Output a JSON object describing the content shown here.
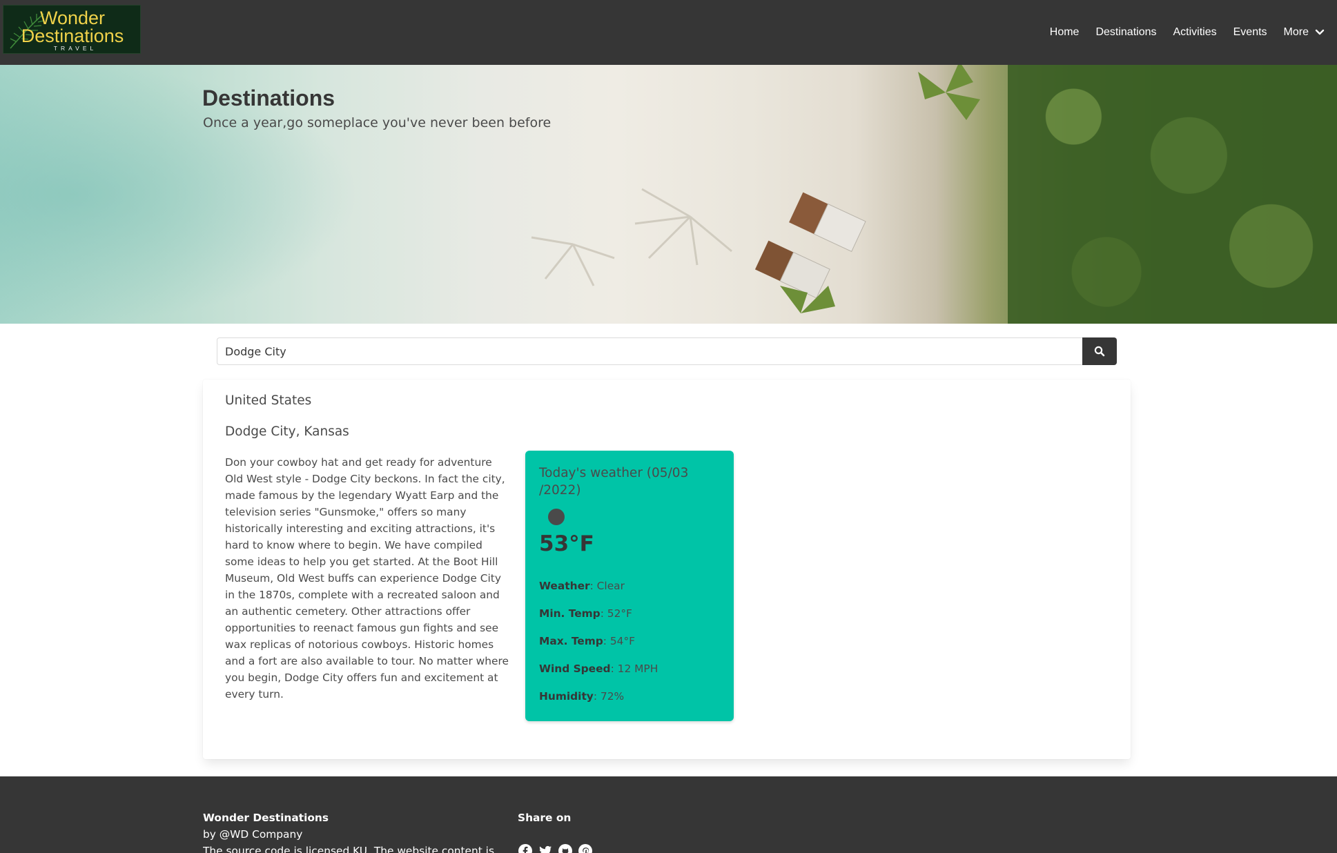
{
  "brand": {
    "logo_line1": "Wonder",
    "logo_line2": "Destinations",
    "logo_line3": "TRAVEL"
  },
  "nav": {
    "items": [
      {
        "label": "Home"
      },
      {
        "label": "Destinations"
      },
      {
        "label": "Activities"
      },
      {
        "label": "Events"
      },
      {
        "label": "More"
      }
    ]
  },
  "hero": {
    "title": "Destinations",
    "subtitle": "Once a year,go someplace you've never been before"
  },
  "search": {
    "value": "Dodge City",
    "button_icon": "search-icon"
  },
  "result": {
    "country": "United States",
    "city": "Dodge City, Kansas",
    "description": "Don your cowboy hat and get ready for adventure Old West style - Dodge City beckons. In fact the city, made famous by the legendary Wyatt Earp and the television series \"Gunsmoke,\" offers so many historically interesting and exciting attractions, it's hard to know where to begin. We have compiled some ideas to help you get started. At the Boot Hill Museum, Old West buffs can experience Dodge City in the 1870s, complete with a recreated saloon and an authentic cemetery. Other attractions offer opportunities to reenact famous gun fights and see wax replicas of notorious cowboys. Historic homes and a fort are also available to tour. No matter where you begin, Dodge City offers fun and excitement at every turn."
  },
  "weather": {
    "title": "Today's weather (05/03 /2022)",
    "icon": "weather-icon",
    "temperature": "53°F",
    "rows": [
      {
        "label": "Weather",
        "value": ": Clear"
      },
      {
        "label": "Min. Temp",
        "value": ": 52°F"
      },
      {
        "label": "Max. Temp",
        "value": ": 54°F"
      },
      {
        "label": "Wind Speed",
        "value": ": 12 MPH"
      },
      {
        "label": "Humidity",
        "value": ": 72%"
      }
    ],
    "card_color": "#00c4a7"
  },
  "footer": {
    "brand": "Wonder Destinations",
    "by": "by @WD Company",
    "license": "The source code is licensed KU. The website content is",
    "share_label": "Share on",
    "share_icons": [
      "facebook-icon",
      "twitter-icon",
      "github-icon",
      "pinterest-icon"
    ]
  },
  "colors": {
    "navbar": "#363636",
    "accent": "#00c4a7",
    "logo_text": "#f0d24a"
  }
}
